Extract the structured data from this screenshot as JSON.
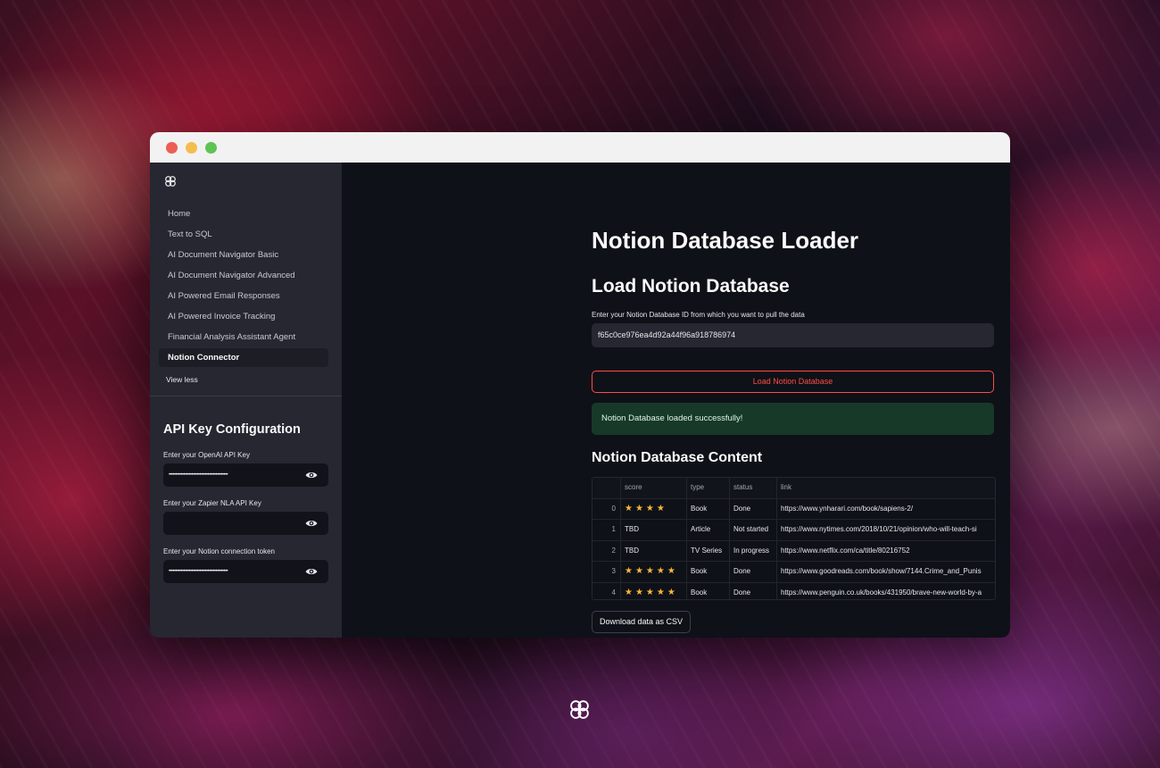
{
  "sidebar": {
    "logo_icon": "app-logo-icon",
    "nav_items": [
      {
        "label": "Home",
        "active": false
      },
      {
        "label": "Text to SQL",
        "active": false
      },
      {
        "label": "AI Document Navigator Basic",
        "active": false
      },
      {
        "label": "AI Document Navigator Advanced",
        "active": false
      },
      {
        "label": "AI Powered Email Responses",
        "active": false
      },
      {
        "label": "AI Powered Invoice Tracking",
        "active": false
      },
      {
        "label": "Financial Analysis Assistant Agent",
        "active": false
      },
      {
        "label": "Notion Connector",
        "active": true
      }
    ],
    "view_less": "View less",
    "api_section": {
      "title": "API Key Configuration",
      "openai_label": "Enter your OpenAI API Key",
      "openai_value": "••••••••••••••••••••••••••••••••••••••••••••",
      "zapier_label": "Enter your Zapier NLA API Key",
      "zapier_value": "",
      "notion_label": "Enter your Notion connection token",
      "notion_value": "••••••••••••••••••••••••••••••••••••••••••••"
    }
  },
  "main": {
    "title": "Notion Database Loader",
    "subtitle": "Load Notion Database",
    "db_input_label": "Enter your Notion Database ID from which you want to pull the data",
    "db_input_value": "f65c0ce976ea4d92a44f96a918786974",
    "load_button": "Load Notion Database",
    "success_message": "Notion Database loaded successfully!",
    "content_title": "Notion Database Content",
    "table": {
      "columns": [
        "",
        "score",
        "type",
        "status",
        "link"
      ],
      "rows": [
        {
          "index": "0",
          "score": "★★★★",
          "type": "Book",
          "status": "Done",
          "link": "https://www.ynharari.com/book/sapiens-2/"
        },
        {
          "index": "1",
          "score": "TBD",
          "type": "Article",
          "status": "Not started",
          "link": "https://www.nytimes.com/2018/10/21/opinion/who-will-teach-si"
        },
        {
          "index": "2",
          "score": "TBD",
          "type": "TV Series",
          "status": "In progress",
          "link": "https://www.netflix.com/ca/title/80216752"
        },
        {
          "index": "3",
          "score": "★★★★★",
          "type": "Book",
          "status": "Done",
          "link": "https://www.goodreads.com/book/show/7144.Crime_and_Punis"
        },
        {
          "index": "4",
          "score": "★★★★★",
          "type": "Book",
          "status": "Done",
          "link": "https://www.penguin.co.uk/books/431950/brave-new-world-by-a"
        }
      ]
    },
    "csv_button": "Download data as CSV"
  },
  "colors": {
    "accent": "#ff4b4b",
    "success_bg": "#173928",
    "star": "#f5b73a",
    "sidebar_bg": "#262730",
    "main_bg": "#0e1117"
  }
}
